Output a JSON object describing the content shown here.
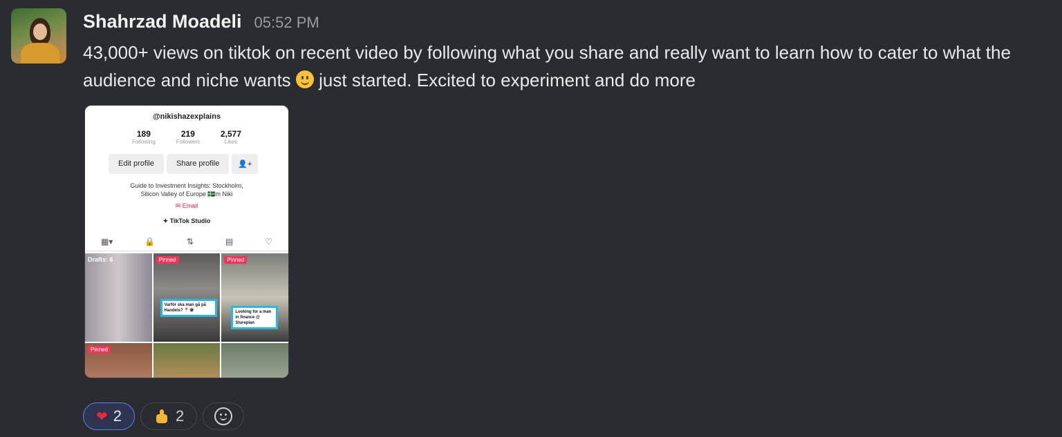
{
  "message": {
    "author": "Shahrzad Moadeli",
    "time": "05:52 PM",
    "text_part1": "43,000+ views on tiktok on recent video by following what you share and really want to learn how to cater to what the audience and niche wants",
    "text_part2": " just started. Excited to experiment and do more",
    "inline_emoji": "slightly-smiling-face"
  },
  "attachment": {
    "handle": "@nikishazexplains",
    "stats": [
      {
        "value": "189",
        "label": "Following"
      },
      {
        "value": "219",
        "label": "Followers"
      },
      {
        "value": "2,577",
        "label": "Likes"
      }
    ],
    "edit_profile": "Edit profile",
    "share_profile": "Share profile",
    "bio_line1": "Guide to Investment Insights: Stockholm,",
    "bio_line2": "Silicon Valley of Europe 🇸🇪m Niki",
    "email": "Email",
    "studio": "TikTok Studio",
    "drafts": "Drafts: 6",
    "pinned": "Pinned",
    "caption1": "Varför ska man gå på Handels? 📍🎓",
    "caption2": "Looking for a man in finance @ Stureplan"
  },
  "reactions": [
    {
      "emoji": "heart",
      "count": "2",
      "active": true
    },
    {
      "emoji": "thumbs-up",
      "count": "2",
      "active": false
    }
  ],
  "colors": {
    "background": "#2b2c31",
    "accent": "#5a82ff"
  }
}
